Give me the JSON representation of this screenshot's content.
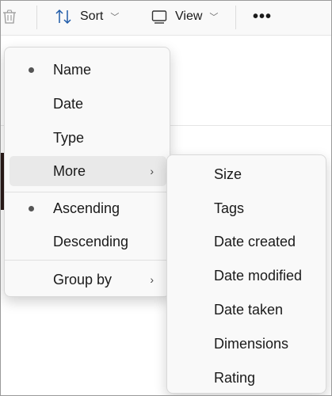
{
  "toolbar": {
    "sort_label": "Sort",
    "view_label": "View",
    "more_label": "•••",
    "icons": {
      "delete": "trash-icon",
      "sort": "sort-arrows-icon",
      "view": "view-icon",
      "chevron": "chevron-down-icon"
    }
  },
  "sort_menu": {
    "items": [
      {
        "label": "Name",
        "selected": true
      },
      {
        "label": "Date",
        "selected": false
      },
      {
        "label": "Type",
        "selected": false
      },
      {
        "label": "More",
        "selected": false,
        "submenu": true,
        "arrow": "›"
      }
    ],
    "order": [
      {
        "label": "Ascending",
        "selected": true
      },
      {
        "label": "Descending",
        "selected": false
      }
    ],
    "group_by": {
      "label": "Group by",
      "arrow": "›"
    }
  },
  "more_submenu": {
    "items": [
      "Size",
      "Tags",
      "Date created",
      "Date modified",
      "Date taken",
      "Dimensions",
      "Rating"
    ]
  }
}
